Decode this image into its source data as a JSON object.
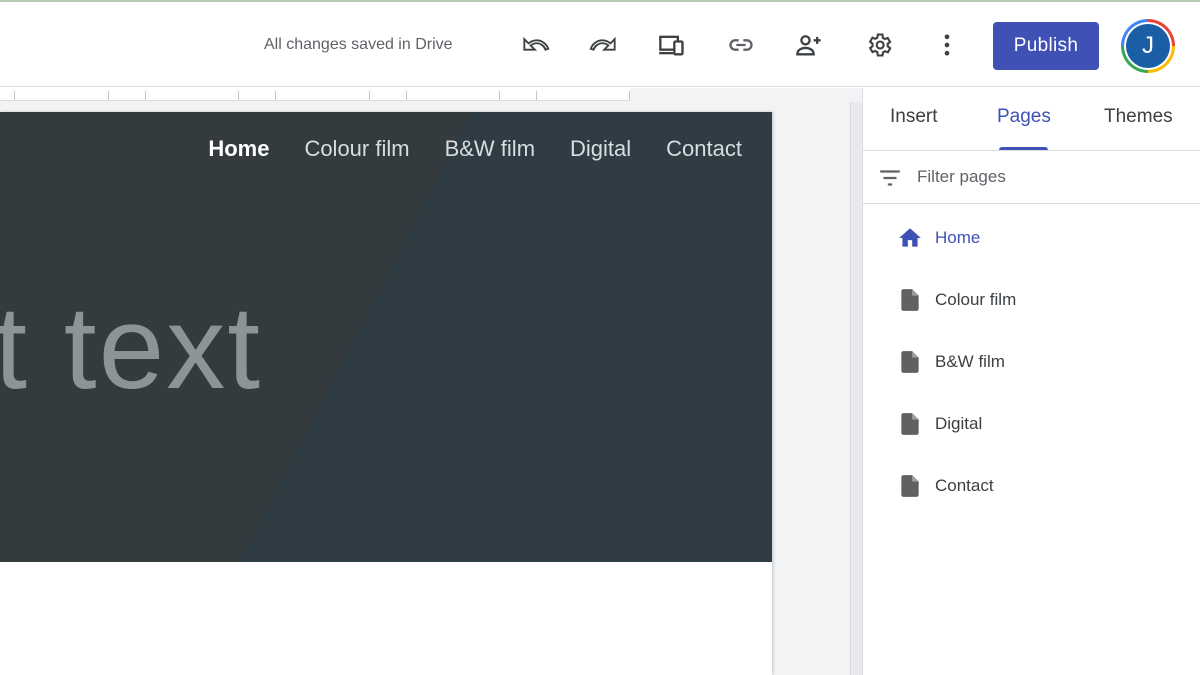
{
  "toolbar": {
    "save_status": "All changes saved in Drive",
    "publish_label": "Publish",
    "avatar_initial": "J",
    "icons": [
      "undo-icon",
      "redo-icon",
      "preview-devices-icon",
      "link-icon",
      "share-add-person-icon",
      "settings-gear-icon",
      "more-vert-icon"
    ]
  },
  "site": {
    "nav": [
      "Home",
      "Colour film",
      "B&W film",
      "Digital",
      "Contact"
    ],
    "active_nav": "Home",
    "hero_title": "it text"
  },
  "panel": {
    "tabs": [
      "Insert",
      "Pages",
      "Themes"
    ],
    "active_tab": "Pages",
    "filter_placeholder": "Filter pages",
    "pages": [
      {
        "label": "Home",
        "icon": "home-icon",
        "active": true
      },
      {
        "label": "Colour film",
        "icon": "page-icon",
        "active": false
      },
      {
        "label": "B&W film",
        "icon": "page-icon",
        "active": false
      },
      {
        "label": "Digital",
        "icon": "page-icon",
        "active": false
      },
      {
        "label": "Contact",
        "icon": "page-icon",
        "active": false
      }
    ]
  },
  "colors": {
    "accent": "#3f51b5",
    "hero_dark": "#333b3f",
    "hero_teal": "#2f3c43",
    "text_grey": "#5f6368"
  }
}
